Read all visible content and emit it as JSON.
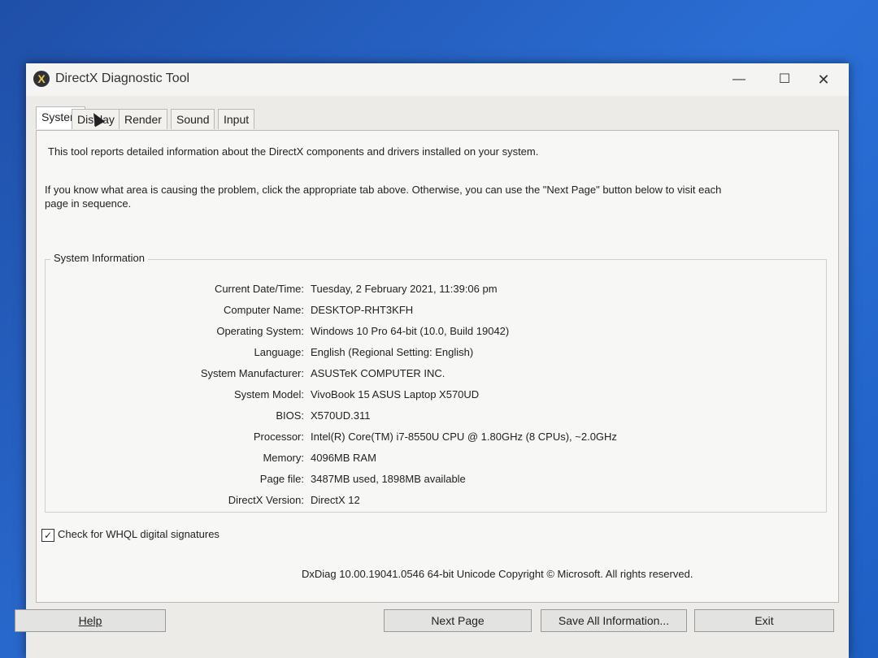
{
  "window": {
    "title": "DirectX Diagnostic Tool",
    "app_icon_glyph": "X",
    "close_glyph": "✕",
    "minimize_glyph": "—",
    "maximize_glyph": "☐"
  },
  "tabs": [
    {
      "label": "System",
      "active": true
    },
    {
      "label": "Display",
      "active": false
    },
    {
      "label": "Render",
      "active": false
    },
    {
      "label": "Sound",
      "active": false
    },
    {
      "label": "Input",
      "active": false
    }
  ],
  "intro": {
    "line1": "This tool reports detailed information about the DirectX components and drivers installed on your system.",
    "line2": "If you know what area is causing the problem, click the appropriate tab above.  Otherwise, you can use the \"Next Page\" button below to visit each page in sequence."
  },
  "system_info": {
    "group_label": "System Information",
    "rows": [
      {
        "label": "Current Date/Time:",
        "value": "Tuesday, 2 February 2021, 11:39:06 pm"
      },
      {
        "label": "Computer Name:",
        "value": "DESKTOP-RHT3KFH"
      },
      {
        "label": "Operating System:",
        "value": "Windows 10 Pro 64-bit (10.0, Build 19042)"
      },
      {
        "label": "Language:",
        "value": "English (Regional Setting: English)"
      },
      {
        "label": "System Manufacturer:",
        "value": "ASUSTeK COMPUTER INC."
      },
      {
        "label": "System Model:",
        "value": "VivoBook 15 ASUS Laptop X570UD"
      },
      {
        "label": "BIOS:",
        "value": "X570UD.311"
      },
      {
        "label": "Processor:",
        "value": "Intel(R) Core(TM) i7-8550U CPU @ 1.80GHz (8 CPUs), ~2.0GHz"
      },
      {
        "label": "Memory:",
        "value": "4096MB RAM"
      },
      {
        "label": "Page file:",
        "value": "3487MB used, 1898MB available"
      },
      {
        "label": "DirectX Version:",
        "value": "DirectX 12"
      }
    ]
  },
  "whql": {
    "label": "Check for WHQL digital signatures",
    "checked": true,
    "check_glyph": "✓"
  },
  "footer": {
    "copyright": "DxDiag 10.00.19041.0546 64-bit Unicode  Copyright © Microsoft. All rights reserved."
  },
  "buttons": {
    "help": "Help",
    "next_page": "Next Page",
    "save_all": "Save All Information...",
    "exit": "Exit"
  }
}
